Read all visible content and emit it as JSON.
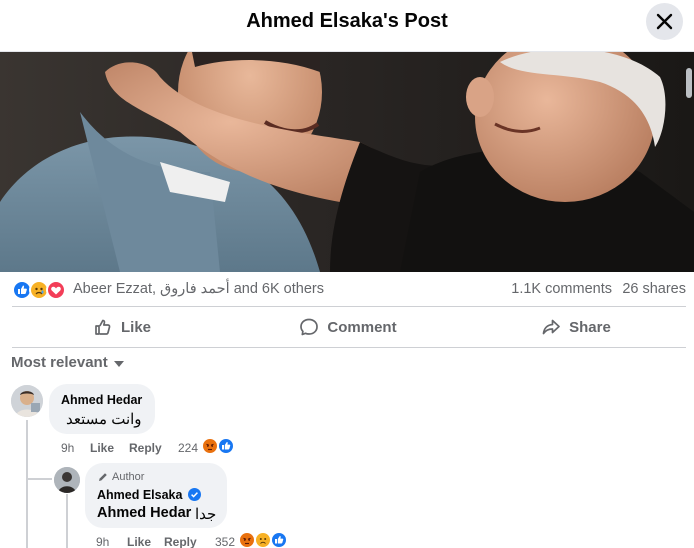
{
  "header": {
    "title": "Ahmed Elsaka's Post"
  },
  "post": {
    "image_alt": "Photo of two men smiling",
    "reaction_names": "Abeer Ezzat, أحمد فاروق and 6K others",
    "comments_count": "1.1K comments",
    "shares_count": "26 shares",
    "reaction_icons": [
      "like",
      "sad",
      "love"
    ]
  },
  "actions": {
    "like": "Like",
    "comment": "Comment",
    "share": "Share"
  },
  "sort": {
    "label": "Most relevant"
  },
  "comments": [
    {
      "author": "Ahmed Hedar",
      "text": "وانت مستعد",
      "time": "9h",
      "like": "Like",
      "reply": "Reply",
      "reaction_count": "224",
      "reaction_icons": [
        "angry",
        "like"
      ]
    },
    {
      "badge": "Author",
      "author": "Ahmed Elsaka",
      "mention": "Ahmed Hedar",
      "text": "جدا",
      "time": "9h",
      "like": "Like",
      "reply": "Reply",
      "reaction_count": "352",
      "reaction_icons": [
        "angry",
        "sad",
        "like"
      ]
    }
  ],
  "colors": {
    "like_blue": "#1877f2",
    "love_red": "#f33e58",
    "reaction_yellow": "#f7b125",
    "angry_orange": "#e9710f",
    "secondary_text": "#65676b",
    "bubble_bg": "#f0f2f5"
  }
}
